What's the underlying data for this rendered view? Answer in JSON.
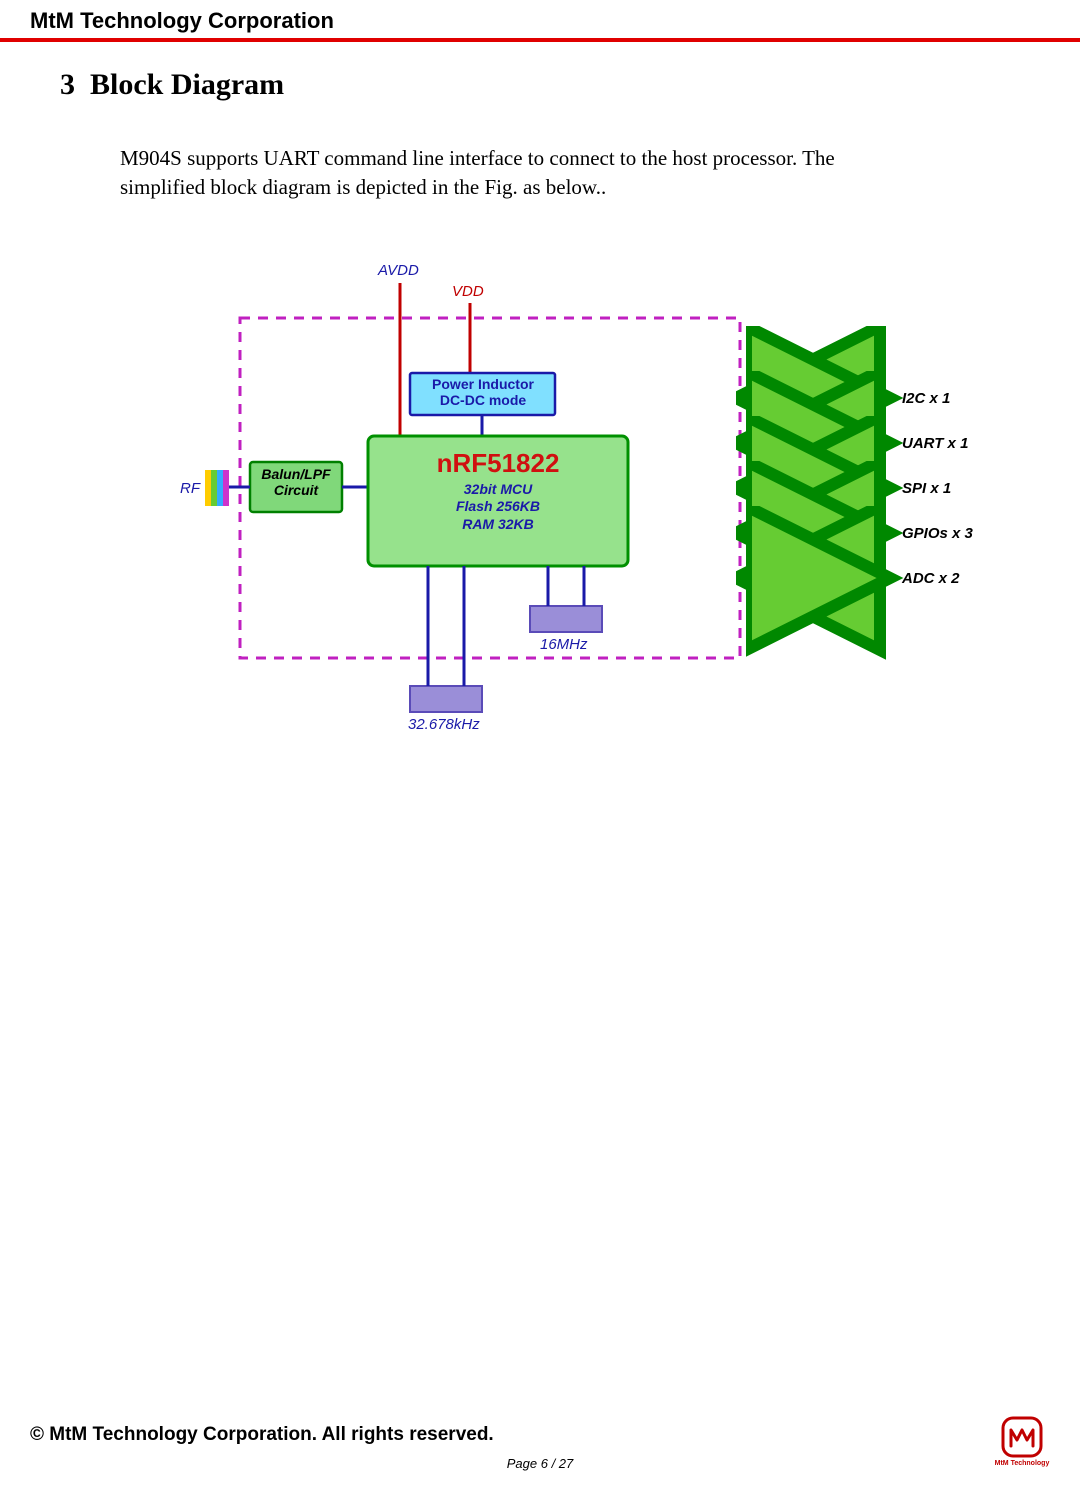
{
  "header": {
    "company": "MtM Technology Corporation"
  },
  "section": {
    "number": "3",
    "title": "Block Diagram",
    "body": "M904S supports UART command line interface to connect to the host processor. The simplified block diagram is depicted in the Fig. as below.."
  },
  "diagram": {
    "avdd": "AVDD",
    "vdd": "VDD",
    "rf": "RF",
    "balun": {
      "line1": "Balun/LPF",
      "line2": "Circuit"
    },
    "power": {
      "line1": "Power Inductor",
      "line2": "DC-DC mode"
    },
    "mcu": {
      "name": "nRF51822",
      "l1": "32bit MCU",
      "l2": "Flash 256KB",
      "l3": "RAM 32KB"
    },
    "xtal16": "16MHz",
    "xtal32": "32.678kHz",
    "ports": {
      "i2c": "I2C x 1",
      "uart": "UART x 1",
      "spi": "SPI x 1",
      "gpio": "GPIOs x 3",
      "adc": "ADC x 2"
    }
  },
  "footer": {
    "copyright": "© MtM Technology Corporation. All rights reserved.",
    "page": "Page 6 / 27",
    "logo_text": "MtM Technology"
  }
}
